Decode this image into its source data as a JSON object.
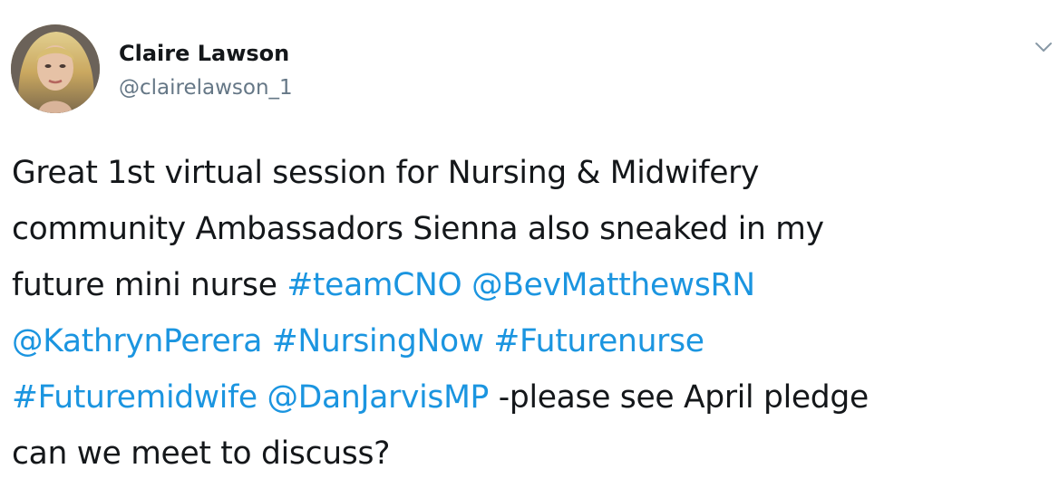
{
  "author": {
    "name": "Claire Lawson",
    "handle": "@clairelawson_1",
    "avatar_icon": "profile-photo"
  },
  "menu": {
    "icon": "chevron-down-icon"
  },
  "tweet": {
    "lines": [
      [
        {
          "text": "Great 1st virtual session for Nursing & Midwifery",
          "type": "text"
        }
      ],
      [
        {
          "text": "community Ambassadors Sienna also sneaked in my",
          "type": "text"
        }
      ],
      [
        {
          "text": "future mini nurse ",
          "type": "text"
        },
        {
          "text": "#teamCNO",
          "type": "hashtag"
        },
        {
          "text": " ",
          "type": "text"
        },
        {
          "text": "@BevMatthewsRN",
          "type": "mention"
        }
      ],
      [
        {
          "text": "@KathrynPerera",
          "type": "mention"
        },
        {
          "text": " ",
          "type": "text"
        },
        {
          "text": "#NursingNow",
          "type": "hashtag"
        },
        {
          "text": " ",
          "type": "text"
        },
        {
          "text": "#Futurenurse",
          "type": "hashtag"
        }
      ],
      [
        {
          "text": "#Futuremidwife",
          "type": "hashtag"
        },
        {
          "text": " ",
          "type": "text"
        },
        {
          "text": "@DanJarvisMP",
          "type": "mention"
        },
        {
          "text": " -please see April pledge",
          "type": "text"
        }
      ],
      [
        {
          "text": "can we meet to discuss?",
          "type": "text"
        }
      ]
    ]
  },
  "colors": {
    "link": "#1b95e0",
    "text": "#14171a",
    "secondary": "#657786"
  }
}
